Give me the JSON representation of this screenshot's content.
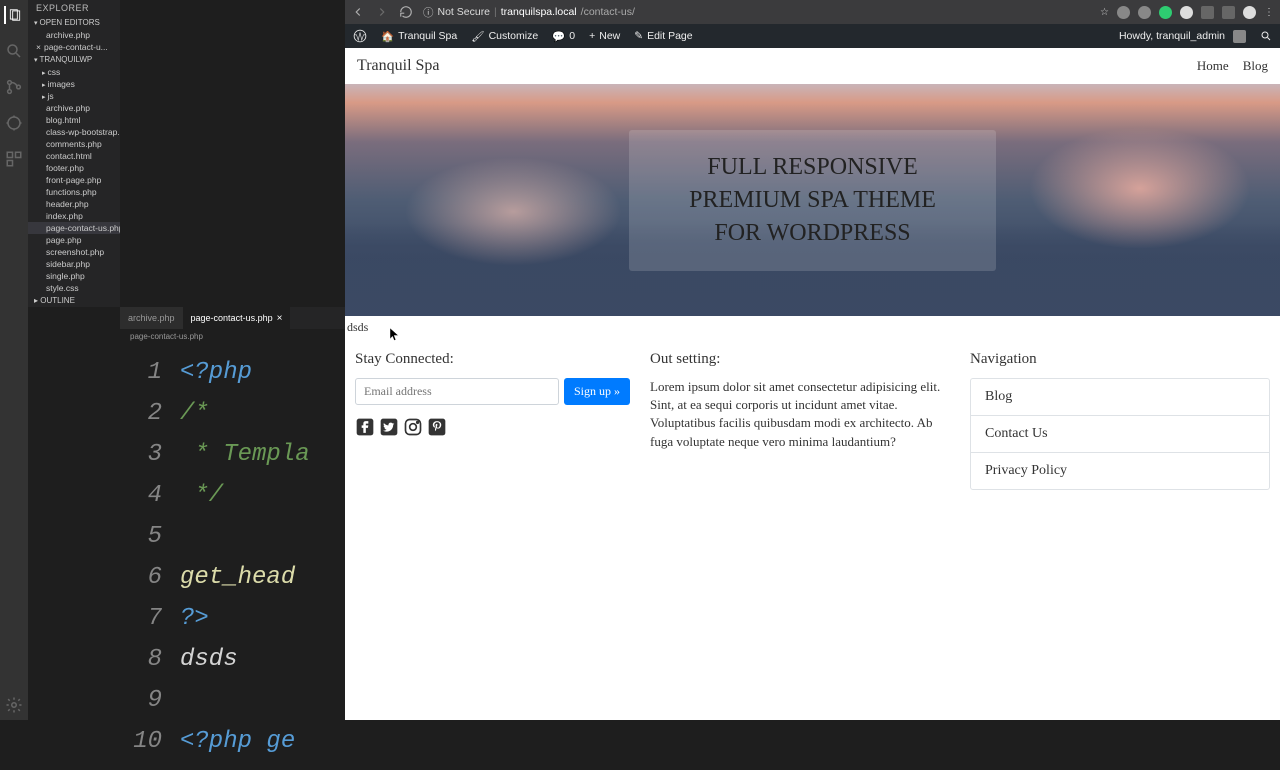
{
  "vscode": {
    "explorer_title": "EXPLORER",
    "open_editors": "OPEN EDITORS",
    "project": "TRANQUILWP",
    "outline": "OUTLINE",
    "open_files": [
      "archive.php",
      "page-contact-u..."
    ],
    "tabs": [
      {
        "label": "archive.php"
      },
      {
        "label": "page-contact-us.php"
      }
    ],
    "breadcrumb": "page-contact-us.php",
    "folders": [
      "css",
      "images",
      "js"
    ],
    "files": [
      "archive.php",
      "blog.html",
      "class-wp-bootstrap...",
      "comments.php",
      "contact.html",
      "footer.php",
      "front-page.php",
      "functions.php",
      "header.php",
      "index.php",
      "page-contact-us.php",
      "page.php",
      "screenshot.php",
      "sidebar.php",
      "single.php",
      "style.css"
    ],
    "lines": [
      {
        "n": "1",
        "cls": "c-php",
        "t": "<?php"
      },
      {
        "n": "2",
        "cls": "c-com",
        "t": "/*"
      },
      {
        "n": "3",
        "cls": "c-com",
        "t": " * Templa"
      },
      {
        "n": "4",
        "cls": "c-com",
        "t": " */"
      },
      {
        "n": "5",
        "cls": "",
        "t": ""
      },
      {
        "n": "6",
        "cls": "c-fn",
        "t": "get_head"
      },
      {
        "n": "7",
        "cls": "c-php",
        "t": "?>"
      },
      {
        "n": "8",
        "cls": "c-txt",
        "t": "dsds"
      },
      {
        "n": "9",
        "cls": "",
        "t": ""
      },
      {
        "n": "10",
        "cls": "c-php",
        "t": "<?php ge"
      }
    ]
  },
  "chrome": {
    "secure": "Not Secure",
    "host": "tranquilspa.local",
    "path": "/contact-us/"
  },
  "wpbar": {
    "site": "Tranquil Spa",
    "customize": "Customize",
    "comments": "0",
    "new": "New",
    "edit": "Edit Page",
    "howdy": "Howdy, tranquil_admin"
  },
  "site": {
    "title": "Tranquil Spa",
    "nav": [
      "Home",
      "Blog"
    ]
  },
  "hero": {
    "l1": "FULL RESPONSIVE",
    "l2": "PREMIUM SPA THEME",
    "l3": "FOR WORDPRESS"
  },
  "content": "dsds",
  "footer": {
    "stay": "Stay Connected:",
    "email_ph": "Email address",
    "signup": "Sign up »",
    "out": "Out setting:",
    "lorem": "Lorem ipsum dolor sit amet consectetur adipisicing elit. Sint, at ea sequi corporis ut incidunt amet vitae. Voluptatibus facilis quibusdam modi ex architecto. Ab fuga voluptate neque vero minima laudantium?",
    "nav_title": "Navigation",
    "nav": [
      "Blog",
      "Contact Us",
      "Privacy Policy"
    ]
  }
}
